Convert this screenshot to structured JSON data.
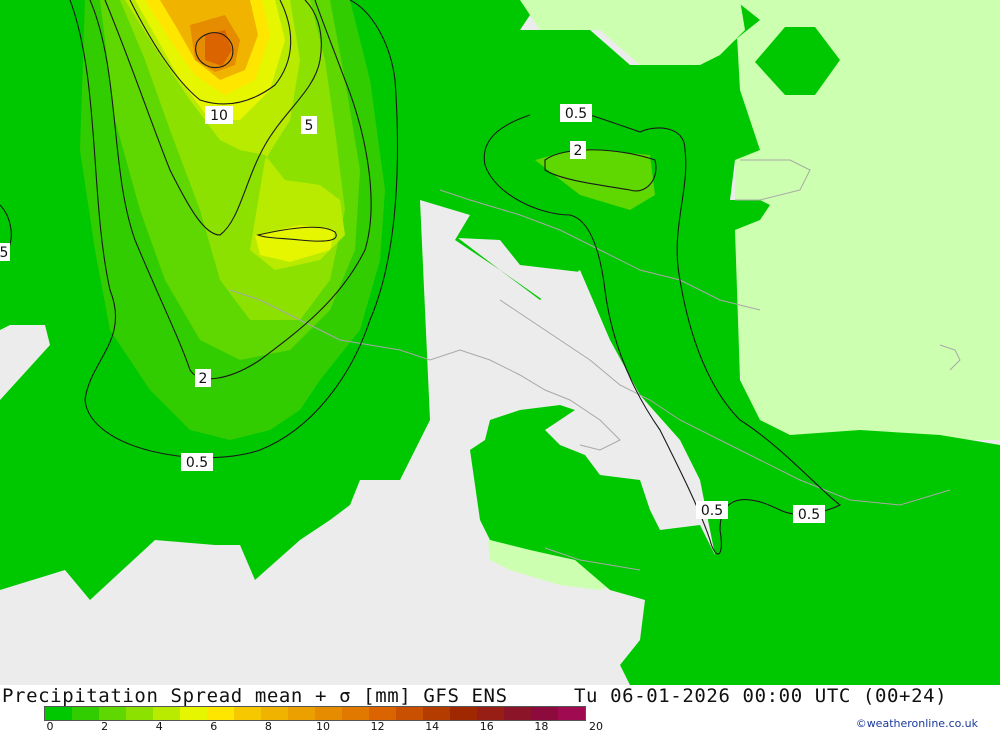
{
  "title": "Precipitation Spread mean + σ [mm] GFS ENS",
  "datetime": "Tu 06-01-2026 00:00 UTC (00+24)",
  "credit": "©weatheronline.co.uk",
  "legend": {
    "colors": [
      "#00c800",
      "#32cd00",
      "#5fd700",
      "#8ce100",
      "#b9eb00",
      "#e6f500",
      "#ffe600",
      "#f5c800",
      "#f0b400",
      "#eba000",
      "#e68c00",
      "#e17800",
      "#dc6400",
      "#c85000",
      "#b43c00",
      "#a02800",
      "#961e14",
      "#8c1428",
      "#8c0a3c",
      "#a00a50"
    ],
    "tick_labels": [
      "0",
      "2",
      "4",
      "6",
      "8",
      "10",
      "12",
      "14",
      "16",
      "18",
      "20"
    ]
  },
  "contour_labels": [
    "10",
    "5",
    "0.5",
    "2",
    "2",
    "0.5",
    "0.5",
    "0.5",
    "5"
  ],
  "colors": {
    "background_land": "#ececec",
    "no_precip_light": "#ccffb0",
    "base_green": "#00c800"
  }
}
